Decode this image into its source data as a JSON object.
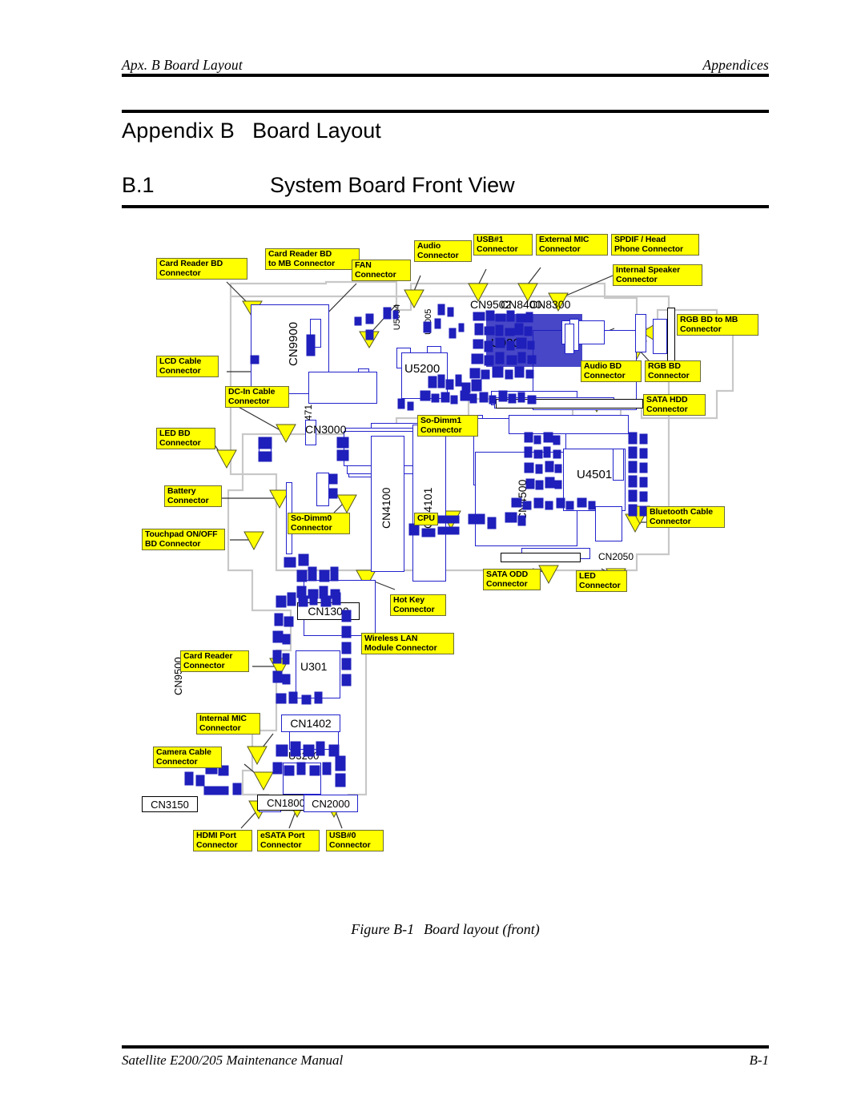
{
  "header": {
    "left": "Apx. B  Board Layout",
    "right": "Appendices"
  },
  "title": {
    "appendix_label": "Appendix B",
    "appendix_name": "Board Layout",
    "section_number": "B.1",
    "section_name": "System Board Front View"
  },
  "figure": {
    "caption_number": "Figure B-1",
    "caption_text": "Board layout (front)",
    "callout_fill": "#FFFF00",
    "callout_border": "#6b6b38",
    "silkscreen_color": "#2222cc"
  },
  "footer": {
    "manual": "Satellite E200/205 Maintenance Manual",
    "page": "B-1"
  },
  "callouts": [
    {
      "id": "card-reader-bd-connector",
      "text": "Card Reader BD\nConnector"
    },
    {
      "id": "card-reader-bd-to-mb-connector",
      "text": "Card Reader BD\nto MB Connector"
    },
    {
      "id": "fan-connector",
      "text": "FAN\nConnector"
    },
    {
      "id": "audio-connector",
      "text": "Audio\nConnector"
    },
    {
      "id": "usb1-connector",
      "text": "USB#1\nConnector"
    },
    {
      "id": "external-mic-connector",
      "text": "External MIC\nConnector"
    },
    {
      "id": "spdif-head-phone-connector",
      "text": "SPDIF / Head\nPhone Connector"
    },
    {
      "id": "internal-speaker-connector",
      "text": "Internal Speaker\nConnector"
    },
    {
      "id": "rgb-bd-to-mb-connector",
      "text": "RGB BD to MB\nConnector"
    },
    {
      "id": "rgb-bd-connector",
      "text": "RGB BD\nConnector"
    },
    {
      "id": "audio-bd-connector",
      "text": "Audio BD\nConnector"
    },
    {
      "id": "sata-hdd-connector",
      "text": "SATA HDD\nConnector"
    },
    {
      "id": "lcd-cable-connector",
      "text": "LCD Cable\nConnector"
    },
    {
      "id": "dc-in-cable-connector",
      "text": "DC-In Cable\nConnector"
    },
    {
      "id": "led-bd-connector",
      "text": "LED BD\nConnector"
    },
    {
      "id": "battery-connector",
      "text": "Battery\nConnector"
    },
    {
      "id": "touchpad-on-off-bd-connector",
      "text": "Touchpad ON/OFF\nBD Connector"
    },
    {
      "id": "so-dimm0-connector",
      "text": "So-Dimm0\nConnector"
    },
    {
      "id": "so-dimm1-connector",
      "text": "So-Dimm1\nConnector"
    },
    {
      "id": "cpu",
      "text": "CPU"
    },
    {
      "id": "bluetooth-cable-connector",
      "text": "Bluetooth Cable\nConnector"
    },
    {
      "id": "sata-odd-connector",
      "text": "SATA ODD\nConnector"
    },
    {
      "id": "led-connector",
      "text": "LED\nConnector"
    },
    {
      "id": "hot-key-connector",
      "text": "Hot Key\nConnector"
    },
    {
      "id": "wireless-lan-module-connector",
      "text": "Wireless LAN\nModule Connector"
    },
    {
      "id": "card-reader-connector",
      "text": "Card Reader\nConnector"
    },
    {
      "id": "internal-mic-connector",
      "text": "Internal MIC\nConnector"
    },
    {
      "id": "camera-cable-connector",
      "text": "Camera Cable\nConnector"
    },
    {
      "id": "hdmi-port-connector",
      "text": "HDMI Port\nConnector"
    },
    {
      "id": "esata-port-connector",
      "text": "eSATA Port\nConnector"
    },
    {
      "id": "usb0-connector",
      "text": "USB#0\nConnector"
    }
  ],
  "silkscreen": [
    {
      "id": "cn9900",
      "text": "CN9900"
    },
    {
      "id": "cn3000",
      "text": "CN3000"
    },
    {
      "id": "cn9500",
      "text": "CN9500"
    },
    {
      "id": "cn4100",
      "text": "CN4100"
    },
    {
      "id": "cn4101",
      "text": "CN4101"
    },
    {
      "id": "cn4500",
      "text": "CN4500"
    },
    {
      "id": "cn1300",
      "text": "CN1300"
    },
    {
      "id": "cn1402",
      "text": "CN1402"
    },
    {
      "id": "cn2050",
      "text": "CN2050"
    },
    {
      "id": "cn3150",
      "text": "CN3150"
    },
    {
      "id": "cn1800",
      "text": "CN1800"
    },
    {
      "id": "cn2000",
      "text": "CN2000"
    },
    {
      "id": "cn9502",
      "text": "CN9502"
    },
    {
      "id": "cn8400",
      "text": "CN8400"
    },
    {
      "id": "cn8300",
      "text": "CN8300"
    },
    {
      "id": "cn4500b",
      "text": "CN4500"
    },
    {
      "id": "u5200",
      "text": "U5200"
    },
    {
      "id": "u5004",
      "text": "U5004"
    },
    {
      "id": "u5005",
      "text": "U5005"
    },
    {
      "id": "u4501",
      "text": "U4501"
    },
    {
      "id": "u301",
      "text": "U301"
    },
    {
      "id": "u9800",
      "text": "U9800"
    },
    {
      "id": "u471",
      "text": "471"
    },
    {
      "id": "u3200",
      "text": "U3200"
    }
  ]
}
